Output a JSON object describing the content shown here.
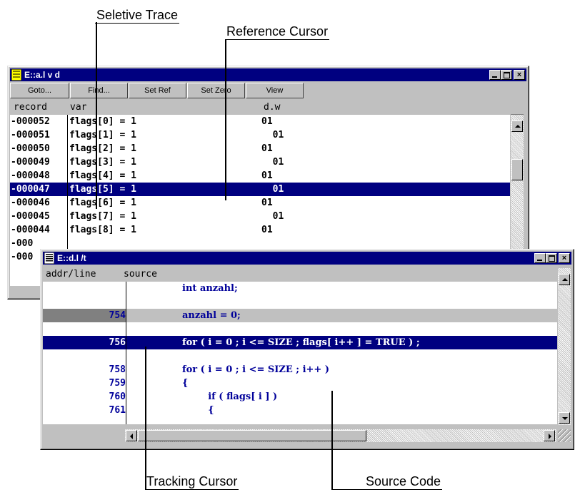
{
  "callouts": {
    "selective_trace": "Seletive Trace",
    "reference_cursor": "Reference Cursor",
    "tracking_cursor": "Tracking Cursor",
    "source_code": "Source Code"
  },
  "trace_window": {
    "title": "E::a.l v d",
    "toolbar": [
      "Goto...",
      "Find...",
      "Set Ref",
      "Set Zero",
      "View"
    ],
    "headers": {
      "record": "record",
      "var": "var",
      "dw": "d.w"
    },
    "rows": [
      {
        "record": "-000052",
        "var": "flags[0] = 1",
        "value": "01"
      },
      {
        "record": "-000051",
        "var": "flags[1] = 1",
        "value": "  01"
      },
      {
        "record": "-000050",
        "var": "flags[2] = 1",
        "value": "01"
      },
      {
        "record": "-000049",
        "var": "flags[3] = 1",
        "value": "  01"
      },
      {
        "record": "-000048",
        "var": "flags[4] = 1",
        "value": "01"
      },
      {
        "record": "-000047",
        "var": "flags[5] = 1",
        "value": "  01"
      },
      {
        "record": "-000046",
        "var": "flags[6] = 1",
        "value": "01"
      },
      {
        "record": "-000045",
        "var": "flags[7] = 1",
        "value": "  01"
      },
      {
        "record": "-000044",
        "var": "flags[8] = 1",
        "value": "01"
      }
    ],
    "partial_records": [
      "-000",
      "-000"
    ]
  },
  "source_window": {
    "title": "E::d.l /t",
    "headers": {
      "addr": "addr/line",
      "source": "source"
    },
    "lines": [
      {
        "num": "",
        "code": "int anzahl;"
      },
      {
        "num": "",
        "code": ""
      },
      {
        "num": "754",
        "code": "anzahl = 0;"
      },
      {
        "num": "",
        "code": ""
      },
      {
        "num": "756",
        "code": "for ( i = 0 ; i <= SIZE ; flags[ i++ ] = TRUE ) ;"
      },
      {
        "num": "",
        "code": ""
      },
      {
        "num": "758",
        "code": "for ( i = 0 ; i <= SIZE ; i++ )"
      },
      {
        "num": "759",
        "code": "{"
      },
      {
        "num": "760",
        "code": "        if ( flags[ i ] )"
      },
      {
        "num": "761",
        "code": "        {"
      }
    ]
  },
  "colors": {
    "selection": "#000080",
    "source_text": "#00009a",
    "window_bg": "#c0c0c0"
  }
}
